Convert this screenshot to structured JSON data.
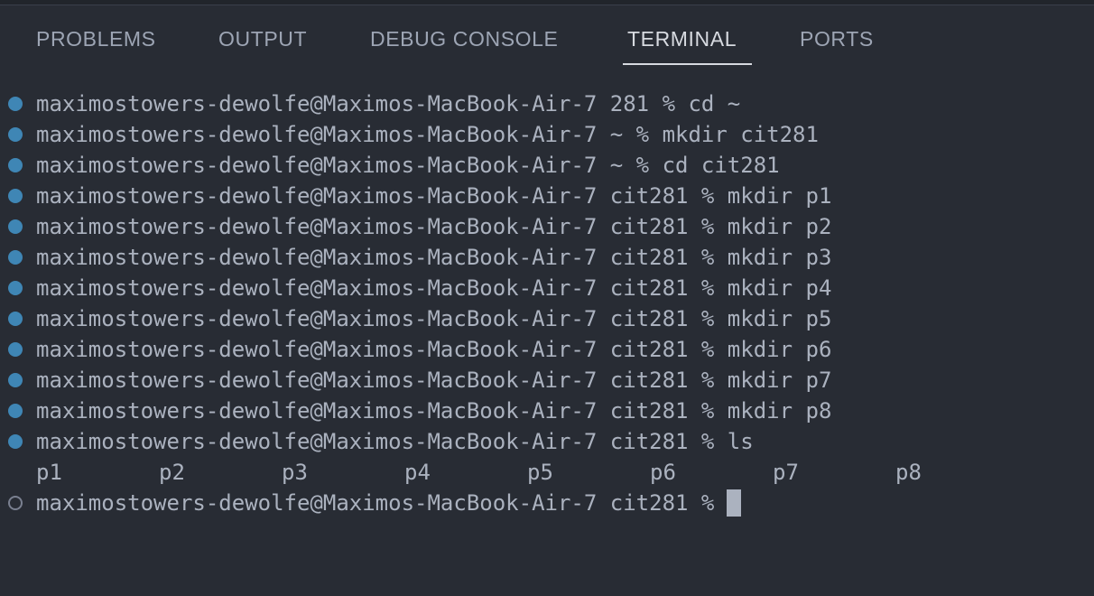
{
  "panel": {
    "tabs": [
      {
        "label": "PROBLEMS",
        "active": false
      },
      {
        "label": "OUTPUT",
        "active": false
      },
      {
        "label": "DEBUG CONSOLE",
        "active": false
      },
      {
        "label": "TERMINAL",
        "active": true
      },
      {
        "label": "PORTS",
        "active": false
      }
    ]
  },
  "terminal": {
    "lines": [
      "maximostowers-dewolfe@Maximos-MacBook-Air-7 281 % cd ~",
      "maximostowers-dewolfe@Maximos-MacBook-Air-7 ~ % mkdir cit281",
      "maximostowers-dewolfe@Maximos-MacBook-Air-7 ~ % cd cit281",
      "maximostowers-dewolfe@Maximos-MacBook-Air-7 cit281 % mkdir p1",
      "maximostowers-dewolfe@Maximos-MacBook-Air-7 cit281 % mkdir p2",
      "maximostowers-dewolfe@Maximos-MacBook-Air-7 cit281 % mkdir p3",
      "maximostowers-dewolfe@Maximos-MacBook-Air-7 cit281 % mkdir p4",
      "maximostowers-dewolfe@Maximos-MacBook-Air-7 cit281 % mkdir p5",
      "maximostowers-dewolfe@Maximos-MacBook-Air-7 cit281 % mkdir p6",
      "maximostowers-dewolfe@Maximos-MacBook-Air-7 cit281 % mkdir p7",
      "maximostowers-dewolfe@Maximos-MacBook-Air-7 cit281 % mkdir p8",
      "maximostowers-dewolfe@Maximos-MacBook-Air-7 cit281 % ls"
    ],
    "ls_output": [
      "p1",
      "p2",
      "p3",
      "p4",
      "p5",
      "p6",
      "p7",
      "p8"
    ],
    "current_prompt": "maximostowers-dewolfe@Maximos-MacBook-Air-7 cit281 %"
  },
  "colors": {
    "background": "#282c34",
    "text": "#abb2bf",
    "success_dot": "#3f86b5"
  },
  "icons": {
    "command_status": "circle-dot-icon",
    "pending_status": "hollow-circle-icon"
  }
}
